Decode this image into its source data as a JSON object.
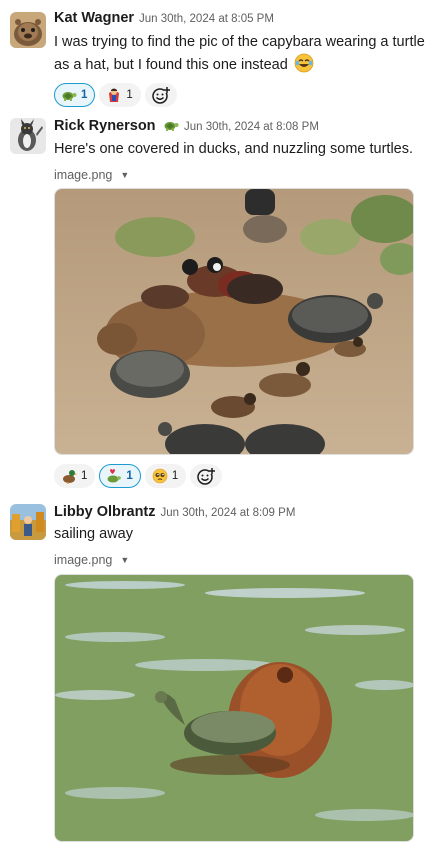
{
  "messages": [
    {
      "author": "Kat Wagner",
      "time": "Jun 30th, 2024 at 8:05 PM",
      "text": "I was trying to find the pic of the capybara wearing a turtle as a hat, but I found this one instead",
      "text_emoji": "joy-emoji",
      "reactions": [
        {
          "emoji": "turtle-emoji",
          "count": "1",
          "mine": true
        },
        {
          "emoji": "superhero-emoji",
          "count": "1",
          "mine": false
        }
      ]
    },
    {
      "author": "Rick Rynerson",
      "status_emoji": "turtle-emoji",
      "time": "Jun 30th, 2024 at 8:08 PM",
      "text": "Here's one covered in ducks, and nuzzling some turtles.",
      "file_name": "image.png",
      "reactions": [
        {
          "emoji": "duck-emoji",
          "count": "1",
          "mine": false
        },
        {
          "emoji": "turtle-heart-emoji",
          "count": "1",
          "mine": true
        },
        {
          "emoji": "pleading-face-emoji",
          "count": "1",
          "mine": false
        }
      ]
    },
    {
      "author": "Libby Olbrantz",
      "time": "Jun 30th, 2024 at 8:09 PM",
      "text": "sailing away",
      "file_name": "image.png"
    }
  ],
  "colors": {
    "link_blue": "#1264a3",
    "reaction_mine_border": "#1d9bd1",
    "reaction_mine_bg": "#e8f5fa",
    "muted_text": "#616061"
  }
}
